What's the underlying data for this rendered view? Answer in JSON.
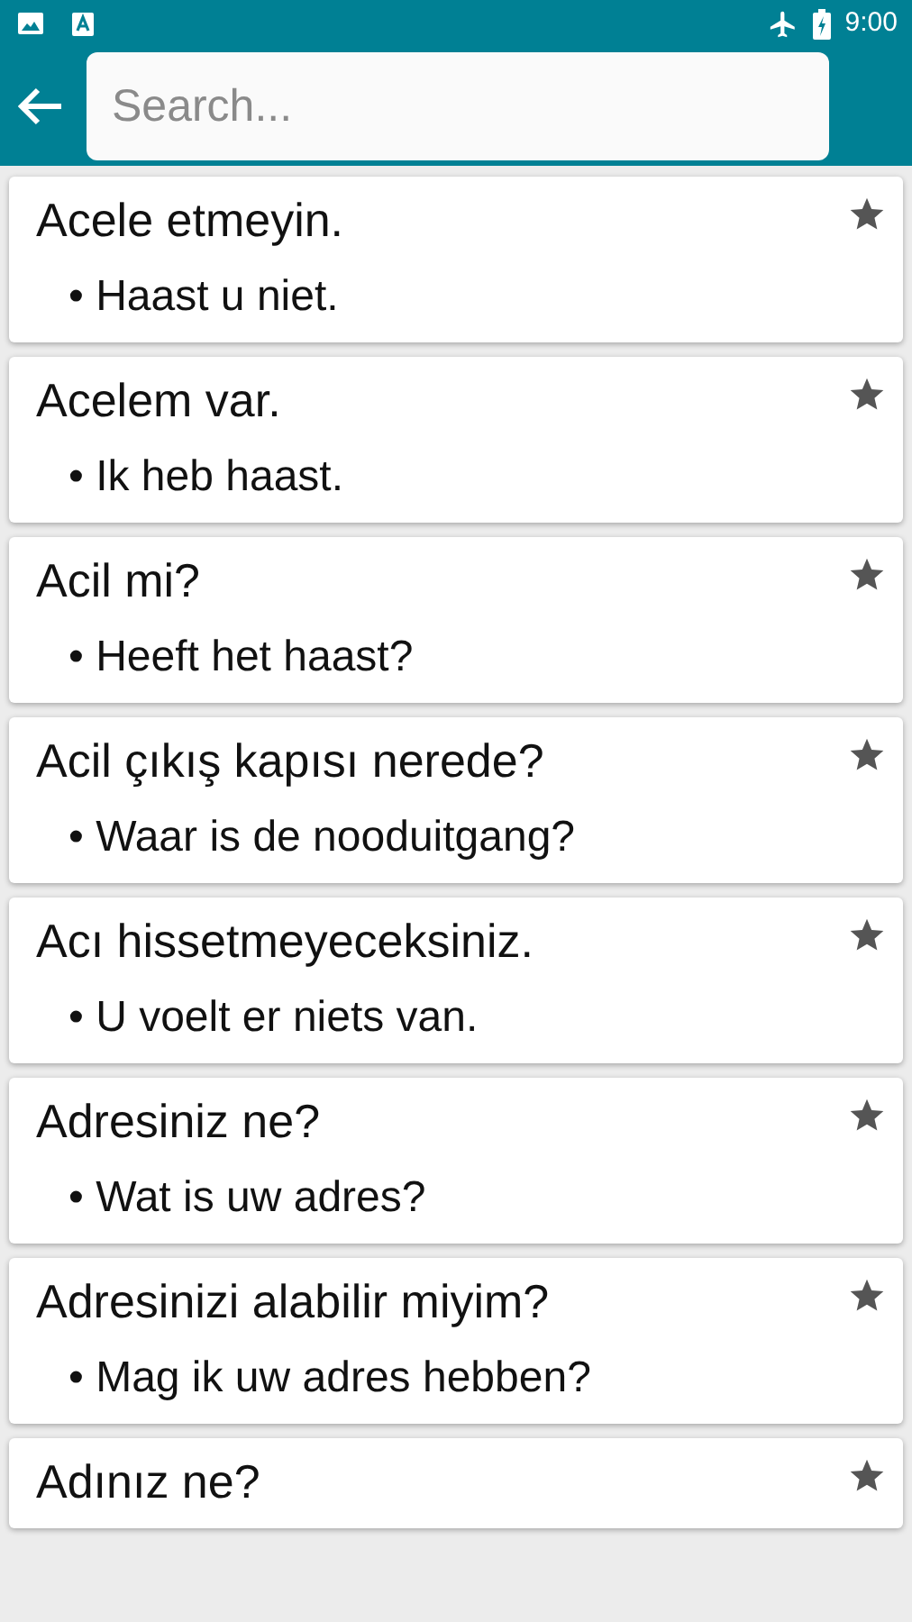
{
  "status_bar": {
    "time": "9:00"
  },
  "search": {
    "placeholder": "Search..."
  },
  "phrases": [
    {
      "phrase": "Acele etmeyin.",
      "translation": "• Haast u niet."
    },
    {
      "phrase": "Acelem var.",
      "translation": "• Ik heb haast."
    },
    {
      "phrase": "Acil mi?",
      "translation": "• Heeft het haast?"
    },
    {
      "phrase": "Acil çıkış kapısı nerede?",
      "translation": "• Waar is de nooduitgang?"
    },
    {
      "phrase": "Acı hissetmeyeceksiniz.",
      "translation": "• U voelt er niets van."
    },
    {
      "phrase": "Adresiniz ne?",
      "translation": "• Wat is uw adres?"
    },
    {
      "phrase": "Adresinizi alabilir miyim?",
      "translation": "• Mag ik uw adres hebben?"
    },
    {
      "phrase": "Adınız ne?"
    }
  ]
}
